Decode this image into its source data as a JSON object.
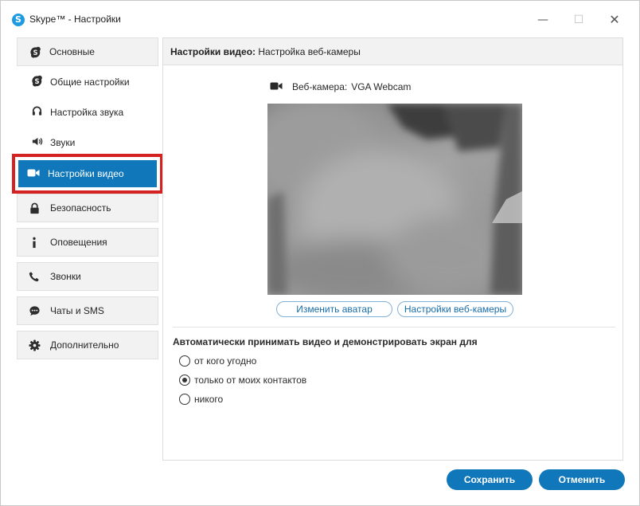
{
  "window": {
    "title": "Skype™ - Настройки",
    "app_icon_letter": "S",
    "minimize_glyph": "—",
    "maximize_glyph": "☐",
    "close_glyph": "✕"
  },
  "sidebar": {
    "main_item": {
      "label": "Основные",
      "icon": "skype-icon"
    },
    "sub_items": [
      {
        "label": "Общие настройки",
        "icon": "skype-icon"
      },
      {
        "label": "Настройка звука",
        "icon": "headset-icon"
      },
      {
        "label": "Звуки",
        "icon": "speaker-icon"
      }
    ],
    "active_item": {
      "label": "Настройки видео",
      "icon": "video-camera-icon"
    },
    "lower_items": [
      {
        "label": "Безопасность",
        "icon": "lock-icon"
      },
      {
        "label": "Оповещения",
        "icon": "info-icon"
      },
      {
        "label": "Звонки",
        "icon": "phone-icon"
      },
      {
        "label": "Чаты и SMS",
        "icon": "chat-icon"
      },
      {
        "label": "Дополнительно",
        "icon": "gear-icon"
      }
    ]
  },
  "content": {
    "header_bold": "Настройки видео:",
    "header_rest": "Настройка веб-камеры",
    "webcam_label": "Веб-камера:",
    "webcam_value": "VGA Webcam",
    "change_avatar_button": "Изменить аватар",
    "webcam_settings_button": "Настройки веб-камеры",
    "auto_accept_title": "Автоматически принимать видео и демонстрировать экран для",
    "options": [
      {
        "label": "от кого угодно",
        "checked": false
      },
      {
        "label": "только от моих контактов",
        "checked": true
      },
      {
        "label": "никого",
        "checked": false
      }
    ]
  },
  "footer": {
    "save_label": "Сохранить",
    "cancel_label": "Отменить"
  },
  "colors": {
    "accent": "#0f77ba",
    "highlight_border": "#d42121",
    "panel_bg": "#f2f2f2"
  }
}
